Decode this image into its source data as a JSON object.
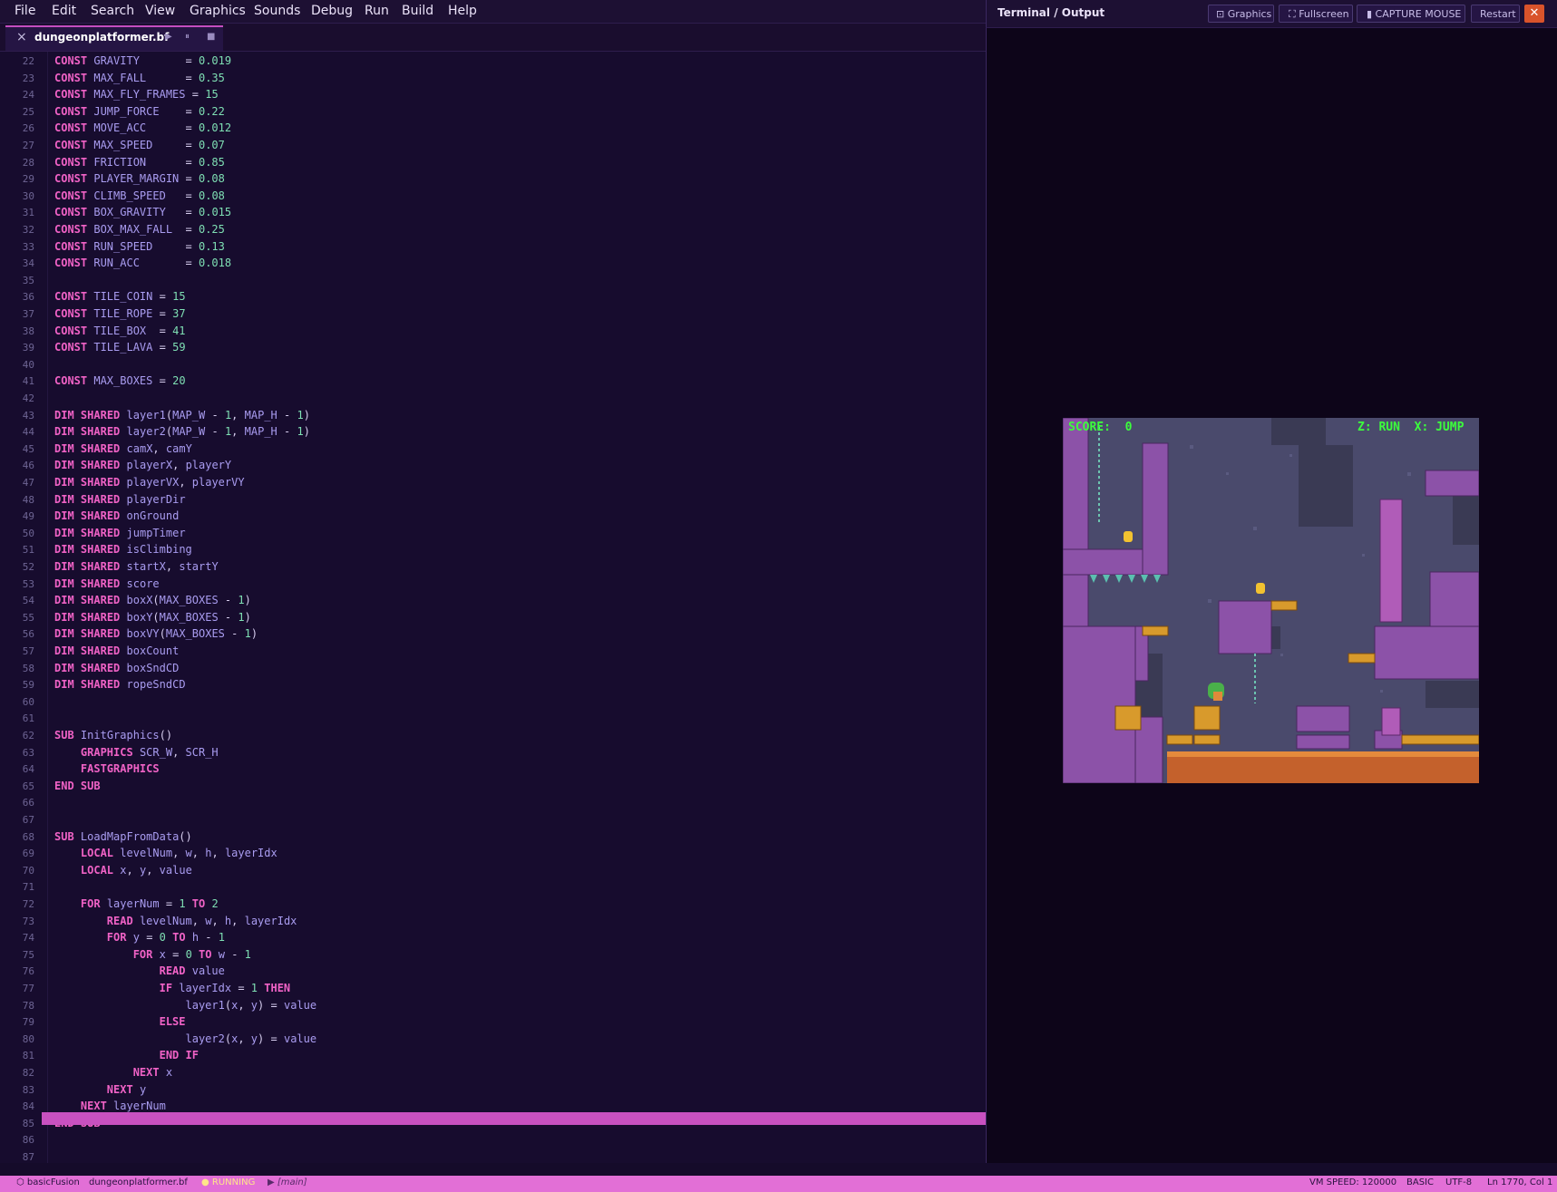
{
  "menu": [
    "File",
    "Edit",
    "Search",
    "View",
    "Graphics",
    "Sounds",
    "Debug",
    "Run",
    "Build",
    "Help"
  ],
  "tab": {
    "filename": "dungeonplatformer.bf",
    "close_icon": "×",
    "play_icon": "▶",
    "pause_icon": "⏸",
    "stop_icon": "■"
  },
  "terminal": {
    "title": "Terminal / Output",
    "buttons": {
      "graphics": "⊡ Graphics",
      "fullscreen": "⛶ Fullscreen",
      "capture": "▮ CAPTURE MOUSE",
      "restart": "Restart"
    },
    "close_icon": "✕"
  },
  "game": {
    "score": "SCORE:  0",
    "controls": "Z: RUN  X: JUMP"
  },
  "status": {
    "project": "⬡ basicFusion",
    "file": "dungeonplatformer.bf",
    "state": "● RUNNING",
    "branch": "▶ [main]",
    "vm_speed": "VM SPEED: 120000",
    "language": "BASIC",
    "encoding": "UTF-8",
    "position": "Ln 1770, Col 1"
  },
  "colors": {
    "keyword": "#f062c6",
    "identifier": "#a99cf0",
    "number": "#7fe0b4",
    "accent": "#e26fd6"
  },
  "code": [
    {
      "n": 22,
      "t": "CONST GRAVITY       = 0.019"
    },
    {
      "n": 23,
      "t": "CONST MAX_FALL      = 0.35"
    },
    {
      "n": 24,
      "t": "CONST MAX_FLY_FRAMES = 15"
    },
    {
      "n": 25,
      "t": "CONST JUMP_FORCE    = 0.22"
    },
    {
      "n": 26,
      "t": "CONST MOVE_ACC      = 0.012"
    },
    {
      "n": 27,
      "t": "CONST MAX_SPEED     = 0.07"
    },
    {
      "n": 28,
      "t": "CONST FRICTION      = 0.85"
    },
    {
      "n": 29,
      "t": "CONST PLAYER_MARGIN = 0.08"
    },
    {
      "n": 30,
      "t": "CONST CLIMB_SPEED   = 0.08"
    },
    {
      "n": 31,
      "t": "CONST BOX_GRAVITY   = 0.015"
    },
    {
      "n": 32,
      "t": "CONST BOX_MAX_FALL  = 0.25"
    },
    {
      "n": 33,
      "t": "CONST RUN_SPEED     = 0.13"
    },
    {
      "n": 34,
      "t": "CONST RUN_ACC       = 0.018"
    },
    {
      "n": 35,
      "t": ""
    },
    {
      "n": 36,
      "t": "CONST TILE_COIN = 15"
    },
    {
      "n": 37,
      "t": "CONST TILE_ROPE = 37"
    },
    {
      "n": 38,
      "t": "CONST TILE_BOX  = 41"
    },
    {
      "n": 39,
      "t": "CONST TILE_LAVA = 59"
    },
    {
      "n": 40,
      "t": ""
    },
    {
      "n": 41,
      "t": "CONST MAX_BOXES = 20"
    },
    {
      "n": 42,
      "t": ""
    },
    {
      "n": 43,
      "t": "DIM SHARED layer1(MAP_W - 1, MAP_H - 1)"
    },
    {
      "n": 44,
      "t": "DIM SHARED layer2(MAP_W - 1, MAP_H - 1)"
    },
    {
      "n": 45,
      "t": "DIM SHARED camX, camY"
    },
    {
      "n": 46,
      "t": "DIM SHARED playerX, playerY"
    },
    {
      "n": 47,
      "t": "DIM SHARED playerVX, playerVY"
    },
    {
      "n": 48,
      "t": "DIM SHARED playerDir"
    },
    {
      "n": 49,
      "t": "DIM SHARED onGround"
    },
    {
      "n": 50,
      "t": "DIM SHARED jumpTimer"
    },
    {
      "n": 51,
      "t": "DIM SHARED isClimbing"
    },
    {
      "n": 52,
      "t": "DIM SHARED startX, startY"
    },
    {
      "n": 53,
      "t": "DIM SHARED score"
    },
    {
      "n": 54,
      "t": "DIM SHARED boxX(MAX_BOXES - 1)"
    },
    {
      "n": 55,
      "t": "DIM SHARED boxY(MAX_BOXES - 1)"
    },
    {
      "n": 56,
      "t": "DIM SHARED boxVY(MAX_BOXES - 1)"
    },
    {
      "n": 57,
      "t": "DIM SHARED boxCount"
    },
    {
      "n": 58,
      "t": "DIM SHARED boxSndCD"
    },
    {
      "n": 59,
      "t": "DIM SHARED ropeSndCD"
    },
    {
      "n": 60,
      "t": ""
    },
    {
      "n": 61,
      "t": ""
    },
    {
      "n": 62,
      "t": "SUB InitGraphics()"
    },
    {
      "n": 63,
      "t": "    GRAPHICS SCR_W, SCR_H"
    },
    {
      "n": 64,
      "t": "    FASTGRAPHICS"
    },
    {
      "n": 65,
      "t": "END SUB"
    },
    {
      "n": 66,
      "t": ""
    },
    {
      "n": 67,
      "t": ""
    },
    {
      "n": 68,
      "t": "SUB LoadMapFromData()"
    },
    {
      "n": 69,
      "t": "    LOCAL levelNum, w, h, layerIdx"
    },
    {
      "n": 70,
      "t": "    LOCAL x, y, value"
    },
    {
      "n": 71,
      "t": ""
    },
    {
      "n": 72,
      "t": "    FOR layerNum = 1 TO 2"
    },
    {
      "n": 73,
      "t": "        READ levelNum, w, h, layerIdx"
    },
    {
      "n": 74,
      "t": "        FOR y = 0 TO h - 1"
    },
    {
      "n": 75,
      "t": "            FOR x = 0 TO w - 1"
    },
    {
      "n": 76,
      "t": "                READ value"
    },
    {
      "n": 77,
      "t": "                IF layerIdx = 1 THEN"
    },
    {
      "n": 78,
      "t": "                    layer1(x, y) = value"
    },
    {
      "n": 79,
      "t": "                ELSE"
    },
    {
      "n": 80,
      "t": "                    layer2(x, y) = value"
    },
    {
      "n": 81,
      "t": "                END IF"
    },
    {
      "n": 82,
      "t": "            NEXT x"
    },
    {
      "n": 83,
      "t": "        NEXT y"
    },
    {
      "n": 84,
      "t": "    NEXT layerNum"
    },
    {
      "n": 85,
      "t": "END SUB"
    },
    {
      "n": 86,
      "t": ""
    },
    {
      "n": 87,
      "t": ""
    }
  ]
}
